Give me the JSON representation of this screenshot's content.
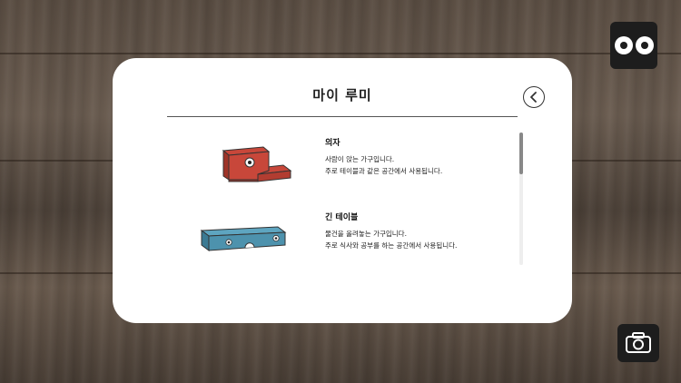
{
  "header_icons": {
    "top_right": "eyes-icon",
    "bottom_right": "camera-icon"
  },
  "modal": {
    "title": "마이 루미",
    "back_icon": "chevron-left-icon"
  },
  "items": [
    {
      "name": "의자",
      "desc_line1": "사람이 앉는 가구입니다.",
      "desc_line2": "주로 테이블과 같은 공간에서 사용됩니다.",
      "color": "#c8473a"
    },
    {
      "name": "긴 테이블",
      "desc_line1": "물건을 올려놓는 가구입니다.",
      "desc_line2": "주로 식사와 공부를 하는 공간에서 사용됩니다.",
      "color": "#4d92ad"
    }
  ]
}
